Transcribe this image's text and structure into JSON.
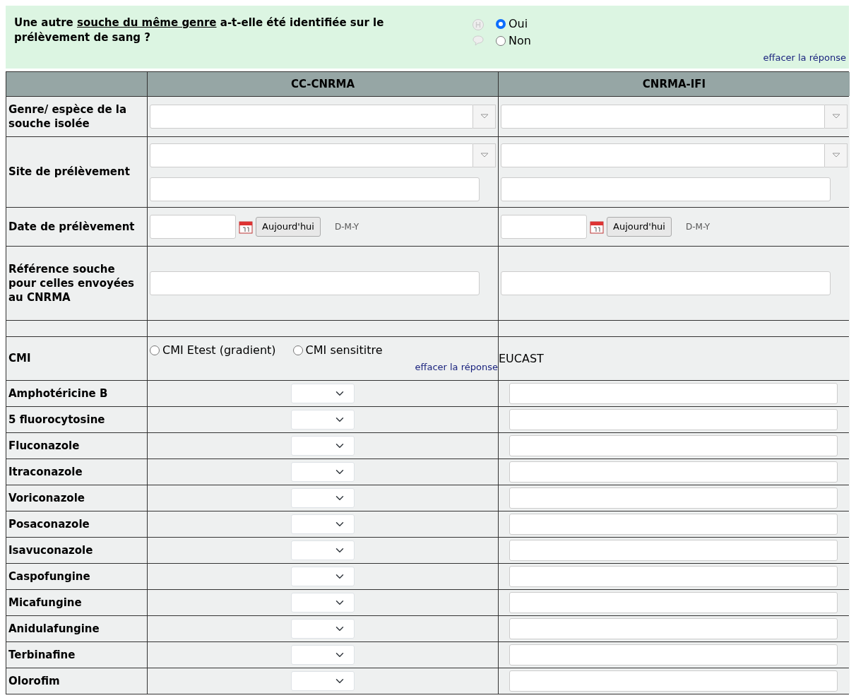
{
  "question": {
    "before": "Une autre ",
    "underlined": "souche du même genre",
    "after": " a-t-elle été identifiée sur le prélèvement de sang ?",
    "options": [
      {
        "label": "Oui",
        "selected": true
      },
      {
        "label": "Non",
        "selected": false
      }
    ],
    "clear_link": "effacer la réponse"
  },
  "table": {
    "columns": [
      "CC-CNRMA",
      "CNRMA-IFI"
    ],
    "rows": [
      {
        "kind": "combo",
        "label": "Genre/ espèce de la souche isolée"
      },
      {
        "kind": "combo_text",
        "label": "Site de prélèvement"
      },
      {
        "kind": "date",
        "label": "Date de prélèvement",
        "cells": [
          {
            "button": "Aujourd'hui",
            "format": "D-M-Y"
          },
          {
            "button": "Aujourd'hui",
            "format": "D-M-Y"
          }
        ]
      },
      {
        "kind": "text",
        "label": "Référence souche pour celles envoyées au CNRMA"
      },
      {
        "kind": "spacer"
      },
      {
        "kind": "cmi",
        "label": "CMI",
        "options": [
          {
            "label": "CMI Etest (gradient)",
            "selected": false
          },
          {
            "label": "CMI sensititre",
            "selected": false
          }
        ],
        "clear_link": "effacer la réponse",
        "method": "EUCAST"
      },
      {
        "kind": "drug",
        "label": "Amphotéricine B"
      },
      {
        "kind": "drug",
        "label": "5 fluorocytosine"
      },
      {
        "kind": "drug",
        "label": "Fluconazole"
      },
      {
        "kind": "drug",
        "label": "Itraconazole"
      },
      {
        "kind": "drug",
        "label": "Voriconazole"
      },
      {
        "kind": "drug",
        "label": "Posaconazole"
      },
      {
        "kind": "drug",
        "label": "Isavuconazole"
      },
      {
        "kind": "drug",
        "label": "Caspofungine"
      },
      {
        "kind": "drug",
        "label": "Micafungine"
      },
      {
        "kind": "drug",
        "label": "Anidulafungine"
      },
      {
        "kind": "drug",
        "label": "Terbinafine"
      },
      {
        "kind": "drug",
        "label": "Olorofim"
      }
    ]
  }
}
